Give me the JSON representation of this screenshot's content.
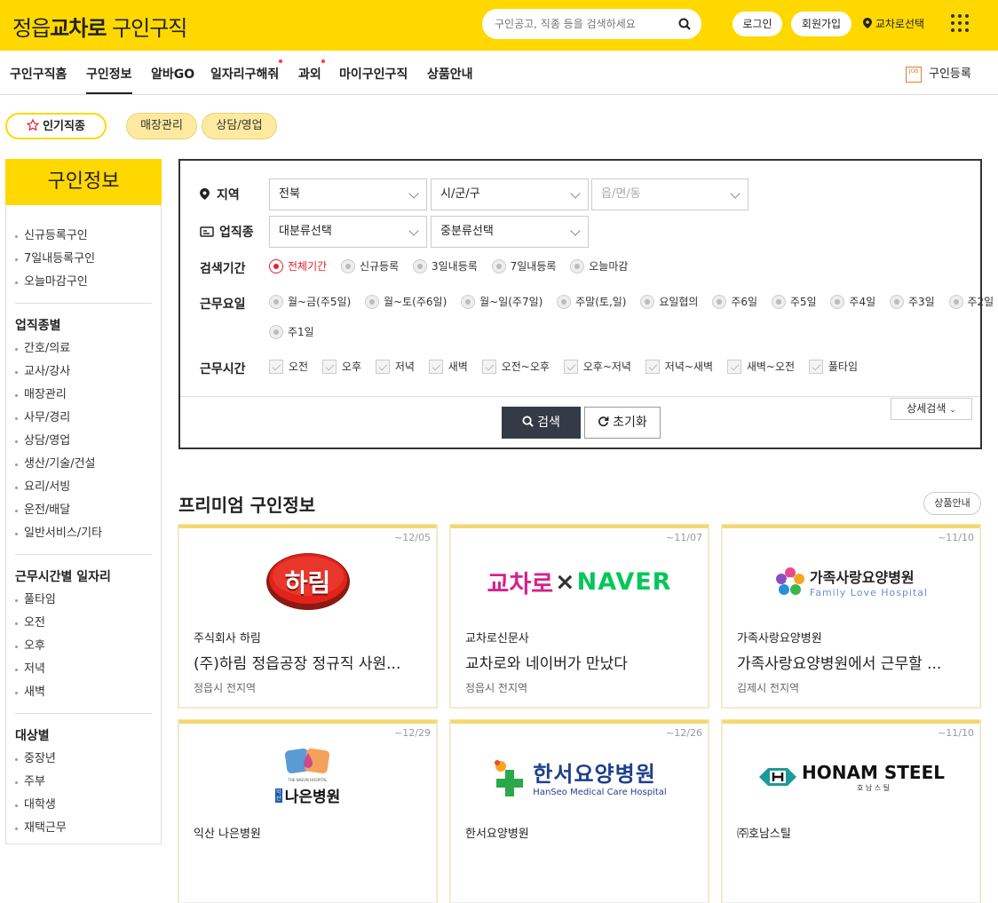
{
  "header": {
    "logo_prefix": "정읍",
    "logo_brand": "교차로",
    "logo_suffix": "구인구직",
    "search_placeholder": "구인공고, 직종 등을 검색하세요",
    "login": "로그인",
    "signup": "회원가입",
    "region": "교차로선택"
  },
  "nav": {
    "items": [
      {
        "label": "구인구직홈"
      },
      {
        "label": "구인정보"
      },
      {
        "label": "알바GO"
      },
      {
        "label": "일자리구해줘"
      },
      {
        "label": "과외"
      },
      {
        "label": "마이구인구직"
      },
      {
        "label": "상품안내"
      }
    ],
    "register_icon_text": "JOB",
    "register": "구인등록"
  },
  "chips": {
    "popular": "인기직종",
    "tags": [
      "매장관리",
      "상담/영업"
    ]
  },
  "sidebar": {
    "title": "구인정보",
    "top_links": [
      "신규등록구인",
      "7일내등록구인",
      "오늘마감구인"
    ],
    "sections": [
      {
        "title": "업직종별",
        "items": [
          "간호/의료",
          "교사/강사",
          "매장관리",
          "사무/경리",
          "상담/영업",
          "생산/기술/건설",
          "요리/서빙",
          "운전/배달",
          "일반서비스/기타"
        ]
      },
      {
        "title": "근무시간별 일자리",
        "items": [
          "풀타임",
          "오전",
          "오후",
          "저녁",
          "새벽"
        ]
      },
      {
        "title": "대상별",
        "items": [
          "중장년",
          "주부",
          "대학생",
          "재택근무"
        ]
      }
    ]
  },
  "filter": {
    "region_label": "지역",
    "region_values": [
      "전북",
      "시/군/구",
      "읍/면/동"
    ],
    "job_label": "업직종",
    "job_values": [
      "대분류선택",
      "중분류선택"
    ],
    "period_label": "검색기간",
    "period_options": [
      "전체기간",
      "신규등록",
      "3일내등록",
      "7일내등록",
      "오늘마감"
    ],
    "period_selected": "전체기간",
    "days_label": "근무요일",
    "days_options": [
      "월~금(주5일)",
      "월~토(주6일)",
      "월~일(주7일)",
      "주말(토,일)",
      "요일협의",
      "주6일",
      "주5일",
      "주4일",
      "주3일",
      "주2일",
      "주1일"
    ],
    "hours_label": "근무시간",
    "hours_options": [
      "오전",
      "오후",
      "저녁",
      "새벽",
      "오전~오후",
      "오후~저녁",
      "저녁~새벽",
      "새벽~오전",
      "풀타임"
    ],
    "search_button": "검색",
    "reset_button": "초기화",
    "detail_button": "상세검색"
  },
  "premium": {
    "title": "프리미엄 구인정보",
    "product_button": "상품안내",
    "cards": [
      {
        "deadline": "~12/05",
        "logo": "하림",
        "company": "주식회사 하림",
        "title": "(주)하림 정읍공장 정규직 사원...",
        "location": "정읍시 전지역"
      },
      {
        "deadline": "~11/07",
        "logo_a": "교차로",
        "logo_x": "×",
        "logo_b": "NAVER",
        "company": "교차로신문사",
        "title": "교차로와 네이버가 만났다",
        "location": "정읍시 전지역"
      },
      {
        "deadline": "~11/10",
        "logo": "가족사랑요양병원",
        "logo_sub": "Family Love Hospital",
        "company": "가족사랑요양병원",
        "title": "가족사랑요양병원에서 근무할 ...",
        "location": "김제시 전지역"
      },
      {
        "deadline": "~12/29",
        "logo_tag": "익산",
        "logo": "나은병원",
        "logo_mini": "THE NAEUN HOSPITAL",
        "company": "익산 나은병원",
        "title": "",
        "location": ""
      },
      {
        "deadline": "~12/26",
        "logo": "한서요양병원",
        "logo_sub": "HanSeo Medical Care Hospital",
        "company": "한서요양병원",
        "title": "",
        "location": ""
      },
      {
        "deadline": "~11/10",
        "logo": "HONAM STEEL",
        "logo_sub": "호 남 스 틸",
        "company": "㈜호남스틸",
        "title": "",
        "location": ""
      }
    ]
  },
  "colors": {
    "brand": "#ffd800",
    "accent_red": "#e5212e",
    "naver_green": "#03c75a",
    "dark_button": "#343a46"
  }
}
